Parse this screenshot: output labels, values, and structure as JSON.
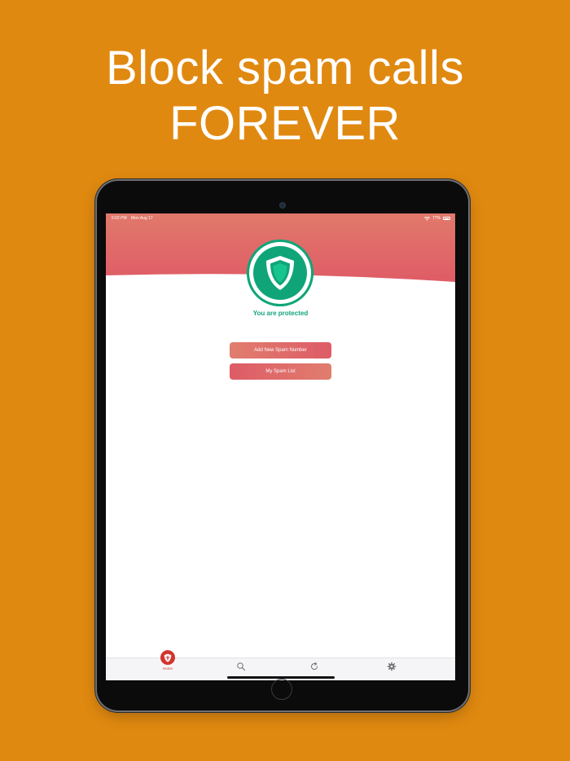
{
  "headline": {
    "line1": "Block spam calls",
    "line2": "FOREVER"
  },
  "status_bar": {
    "time": "6:02 PM",
    "date": "Mon Aug 17",
    "battery": "77%"
  },
  "protection": {
    "status_text": "You are protected"
  },
  "actions": {
    "add_label": "Add New Spam Number",
    "list_label": "My Spam List"
  },
  "tab_bar": {
    "home_label": "Home",
    "tabs": [
      {
        "name": "home",
        "icon": "shield-icon",
        "selected": true
      },
      {
        "name": "search",
        "icon": "search-icon",
        "selected": false
      },
      {
        "name": "refresh",
        "icon": "refresh-icon",
        "selected": false
      },
      {
        "name": "settings",
        "icon": "gear-icon",
        "selected": false
      }
    ]
  },
  "colors": {
    "background": "#E08910",
    "accent_green": "#10A578",
    "header_red": "#E0636A",
    "tab_active": "#D2342E"
  }
}
